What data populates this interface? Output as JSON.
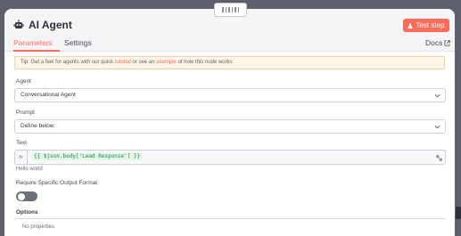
{
  "header": {
    "title": "AI Agent",
    "test_button": "Test step"
  },
  "tabs": [
    {
      "label": "Parameters",
      "active": true
    },
    {
      "label": "Settings",
      "active": false
    }
  ],
  "docs_label": "Docs",
  "tip": {
    "prefix": "Tip: Get a feel for agents with our quick ",
    "link1": "tutorial",
    "middle": " or see an ",
    "link2": "example",
    "suffix": " of how this node works"
  },
  "fields": {
    "agent": {
      "label": "Agent",
      "value": "Conversational Agent"
    },
    "prompt": {
      "label": "Prompt",
      "value": "Define below"
    },
    "text": {
      "label": "Text",
      "fx": "fx",
      "expression": "{{ $json.body['Lead Response'] }}",
      "hint": "Hello world"
    },
    "output_format": {
      "label": "Require Specific Output Format",
      "enabled": false
    }
  },
  "options": {
    "label": "Options",
    "empty_text": "No properties"
  },
  "colors": {
    "accent": "#ff6d5a",
    "expression_green": "#178a4a",
    "tip_bg": "#fff6ea"
  }
}
